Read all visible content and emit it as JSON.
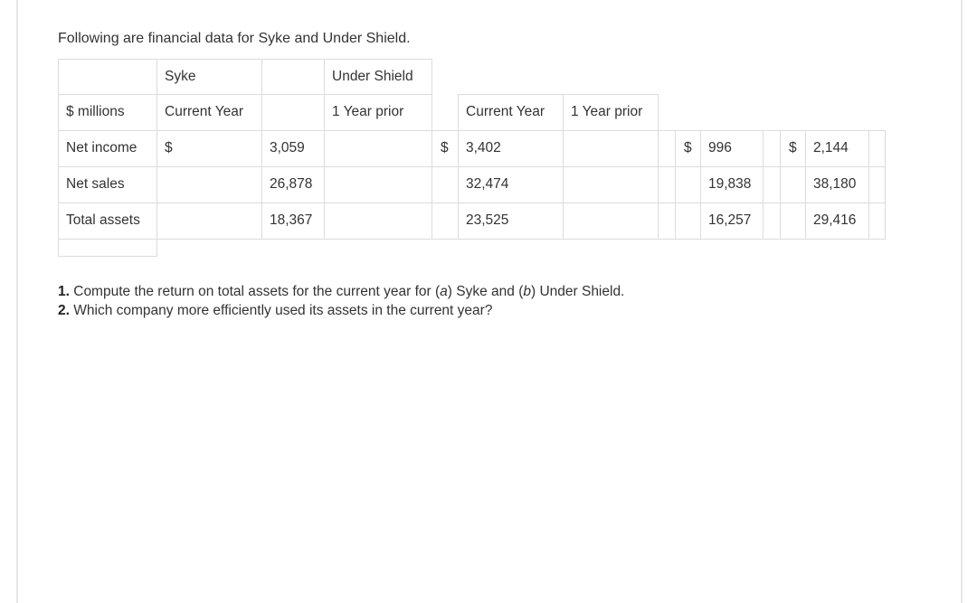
{
  "intro": "Following are financial data for Syke and Under Shield.",
  "table": {
    "row1": {
      "syke": "Syke",
      "under_shield": "Under Shield"
    },
    "row2": {
      "units": "$ millions",
      "syke_current": "Current Year",
      "syke_prior": "1 Year prior",
      "us_current": "Current Year",
      "us_prior": "1 Year prior"
    },
    "rows": [
      {
        "label": "Net income",
        "syke_cur_symbol": "$",
        "syke_cur": "3,059",
        "us_cur_symbol": "$",
        "us_cur": "3,402",
        "syke_prior_symbol": "$",
        "syke_prior": "996",
        "us_prior_symbol": "$",
        "us_prior": "2,144"
      },
      {
        "label": "Net sales",
        "syke_cur_symbol": "",
        "syke_cur": "26,878",
        "us_cur_symbol": "",
        "us_cur": "32,474",
        "syke_prior_symbol": "",
        "syke_prior": "19,838",
        "us_prior_symbol": "",
        "us_prior": "38,180"
      },
      {
        "label": "Total assets",
        "syke_cur_symbol": "",
        "syke_cur": "18,367",
        "us_cur_symbol": "",
        "us_cur": "23,525",
        "syke_prior_symbol": "",
        "syke_prior": "16,257",
        "us_prior_symbol": "",
        "us_prior": "29,416"
      }
    ]
  },
  "questions": [
    {
      "num": "1.",
      "text_before": " Compute the return on total assets for the current year for (",
      "a": "a",
      "mid": ") Syke and (",
      "b": "b",
      "after": ") Under Shield."
    },
    {
      "num": "2.",
      "text": " Which company more efficiently used its assets in the current year?"
    }
  ]
}
